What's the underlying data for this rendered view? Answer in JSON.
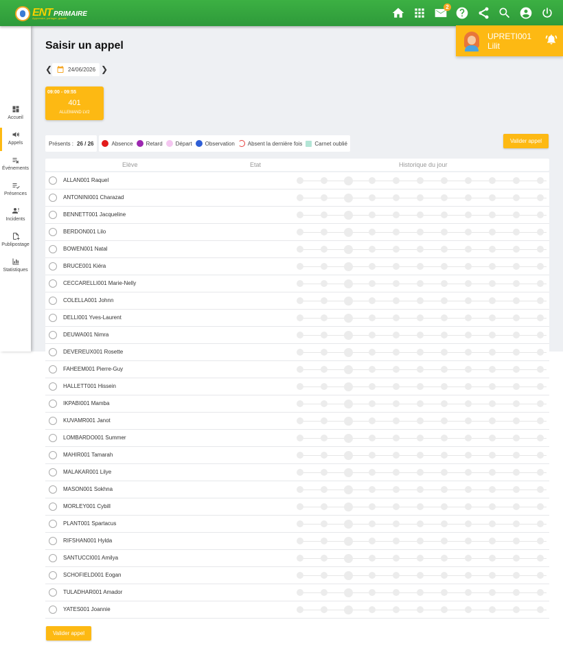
{
  "header": {
    "logo_ent": "ENT",
    "logo_primaire": "PRIMAIRE",
    "logo_tagline": "Apprendre, partager, grandir",
    "icons": [
      "home-icon",
      "apps-icon",
      "mail-icon",
      "help-icon",
      "share-icon",
      "search-icon",
      "account-icon",
      "power-icon"
    ],
    "mail_badge": "2"
  },
  "user": {
    "name": "UPRETI001 Lilit"
  },
  "sidebar": {
    "items": [
      {
        "label": "Accueil",
        "icon": "dashboard-icon"
      },
      {
        "label": "Appels",
        "icon": "megaphone-icon"
      },
      {
        "label": "Événements",
        "icon": "events-icon"
      },
      {
        "label": "Présences",
        "icon": "presences-icon"
      },
      {
        "label": "Incidents",
        "icon": "incidents-icon"
      },
      {
        "label": "Publipostage",
        "icon": "mailing-icon"
      },
      {
        "label": "Statistiques",
        "icon": "stats-icon"
      }
    ]
  },
  "page": {
    "title": "Saisir un appel",
    "date": "24/06/2026"
  },
  "course": {
    "time": "09:00 - 09:55",
    "room": "401",
    "subject": "ALLEMAND LV2"
  },
  "presence": {
    "label": "Présents :",
    "value": "26 / 26"
  },
  "legend": [
    {
      "label": "Absence",
      "color": "#e21b1b"
    },
    {
      "label": "Retard",
      "color": "#9c27b0"
    },
    {
      "label": "Départ",
      "color": "#f4c6f0"
    },
    {
      "label": "Observation",
      "color": "#2f5fd6"
    },
    {
      "label": "Absent la dernière fois",
      "color": "#e53935"
    },
    {
      "label": "Carnet oublié",
      "color": "#b3e5d6"
    }
  ],
  "actions": {
    "validate": "Valider appel"
  },
  "table": {
    "headers": [
      "Elève",
      "Etat",
      "Historique du jour"
    ],
    "students": [
      "ALLAN001 Raquel",
      "ANTONINI001 Charazad",
      "BENNETT001 Jacqueline",
      "BERDON001 Lilo",
      "BOWEN001 Natal",
      "BRUCE001 Kiéra",
      "CECCARELLI001 Marie-Nelly",
      "COLELLA001 Johnn",
      "DELLI001 Yves-Laurent",
      "DEUWA001 Nimra",
      "DEVEREUX001 Rosette",
      "FAHEEM001 Pierre-Guy",
      "HALLETT001 Hissein",
      "IKPABI001 Mamba",
      "KUVAMR001 Janot",
      "LOMBARDO001 Summer",
      "MAHIR001 Tamarah",
      "MALAKAR001 Lilye",
      "MASON001 Sokhna",
      "MORLEY001 Cybill",
      "PLANT001 Spartacus",
      "RIFSHAN001 Hylda",
      "SANTUCCI001 Amilya",
      "SCHOFIELD001 Eogan",
      "TULADHAR001 Amador",
      "YATES001 Joannie"
    ]
  }
}
